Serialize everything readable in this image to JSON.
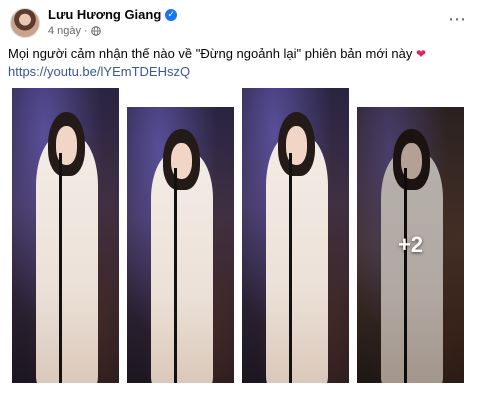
{
  "post": {
    "author": "Lưu Hương Giang",
    "time": "4 ngày",
    "separator": "·",
    "more_icon": "⋯",
    "caption": "Mọi người cảm nhận thế nào về \"Đừng ngoảnh lại\" phiên bản mới này",
    "caption_emoji": "❤",
    "link": "https://youtu.be/lYEmTDEHszQ",
    "verified_icon": "✓"
  },
  "gallery": {
    "extra_count": "+2",
    "photos": [
      {
        "alt": "singer with microphone stand photo 1"
      },
      {
        "alt": "singer with microphone stand photo 2"
      },
      {
        "alt": "singer with microphone stand photo 3"
      },
      {
        "alt": "singer with microphone stand photo 4"
      }
    ]
  },
  "colors": {
    "link": "#385898",
    "verified": "#1877f2",
    "heart": "#e0245e",
    "meta": "#65676b"
  }
}
